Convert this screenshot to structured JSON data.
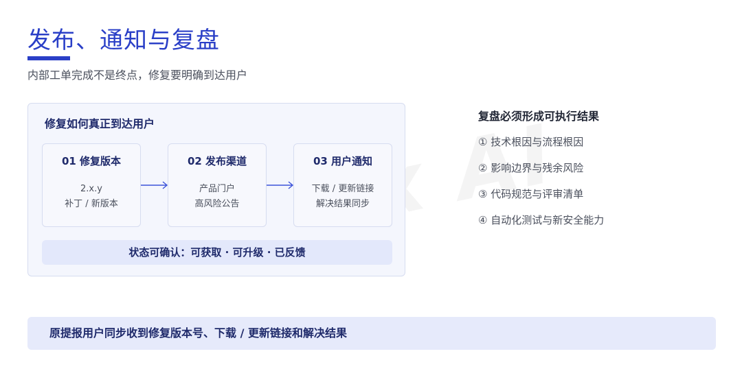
{
  "header": {
    "title": "发布、通知与复盘",
    "subtitle": "内部工单完成不是终点，修复要明确到达用户"
  },
  "watermark": {
    "text": "DB x AI"
  },
  "flow_card": {
    "title": "修复如何真正到达用户",
    "steps": [
      {
        "title": "01  修复版本",
        "lines": [
          "2.x.y",
          "补丁 / 新版本"
        ]
      },
      {
        "title": "02  发布渠道",
        "lines": [
          "产品门户",
          "高风险公告"
        ]
      },
      {
        "title": "03  用户通知",
        "lines": [
          "下载 / 更新链接",
          "解决结果同步"
        ]
      }
    ],
    "status": "状态可确认：可获取 · 可升级 · 已反馈"
  },
  "review": {
    "title": "复盘必须形成可执行结果",
    "items": [
      "① 技术根因与流程根因",
      "② 影响边界与残余风险",
      "③ 代码规范与评审清单",
      "④ 自动化测试与新安全能力"
    ]
  },
  "banner": {
    "text": "原提报用户同步收到修复版本号、下载 / 更新链接和解决结果"
  },
  "colors": {
    "accent": "#2a3fc7",
    "arrow": "#3b52d9",
    "card_bg": "#f4f6fd",
    "banner_bg": "#e6eafb"
  }
}
